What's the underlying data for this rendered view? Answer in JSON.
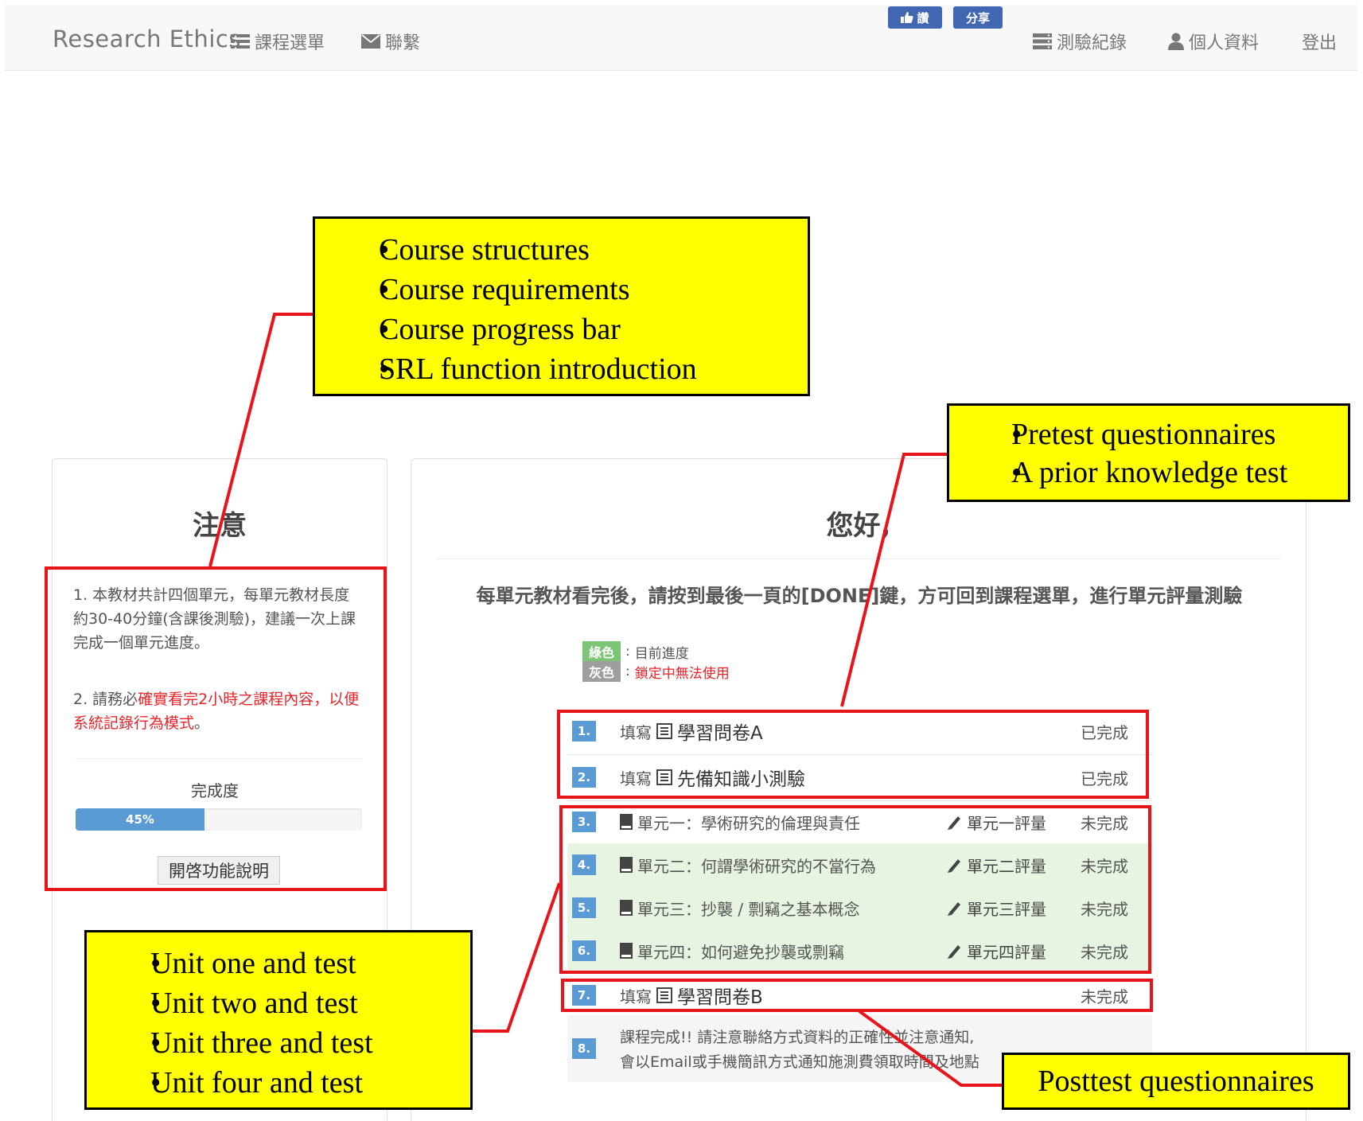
{
  "navbar": {
    "brand": "Research Ethics",
    "course_menu": "課程選單",
    "contact": "聯繫",
    "like": "讚",
    "share": "分享",
    "quiz_records": "測驗紀錄",
    "profile": "個人資料",
    "logout": "登出"
  },
  "notice": {
    "title": "注意",
    "item1": "1. 本教材共計四個單元，每單元教材長度約30-40分鐘(含課後測驗)，建議一次上課完成一個單元進度。",
    "item2_prefix": "2. 請務必",
    "item2_red": "確實看完2小時之課程內容，以便系統記錄行為模式",
    "item2_suffix": "。",
    "progress_label": "完成度",
    "progress_value": 45,
    "progress_text": "45%",
    "function_button": "開啓功能說明"
  },
  "main": {
    "greeting": "您好,",
    "instruction": "每單元教材看完後，請按到最後一頁的[DONE]鍵，方可回到課程選單，進行單元評量測驗",
    "legend": [
      {
        "badge": "綠色",
        "color": "#7cc576",
        "text": "目前進度",
        "text_color": "#555555"
      },
      {
        "badge": "灰色",
        "color": "#9e9e9e",
        "text": "鎖定中無法使用",
        "text_color": "#e8232a"
      }
    ],
    "steps": [
      {
        "num": "1.",
        "prefix": "填寫",
        "label": "學習問卷A",
        "status": "已完成"
      },
      {
        "num": "2.",
        "prefix": "填寫",
        "label": "先備知識小測驗",
        "status": "已完成"
      },
      {
        "num": "3.",
        "label": "單元一：學術研究的倫理與責任",
        "test": "單元一評量",
        "status": "未完成"
      },
      {
        "num": "4.",
        "label": "單元二：何謂學術研究的不當行為",
        "test": "單元二評量",
        "status": "未完成"
      },
      {
        "num": "5.",
        "label": "單元三：抄襲 / 剽竊之基本概念",
        "test": "單元三評量",
        "status": "未完成"
      },
      {
        "num": "6.",
        "label": "單元四：如何避免抄襲或剽竊",
        "test": "單元四評量",
        "status": "未完成"
      },
      {
        "num": "7.",
        "prefix": "填寫",
        "label": "學習問卷B",
        "status": "未完成"
      },
      {
        "num": "8.",
        "line1": "課程完成!! 請注意聯絡方式資料的正確性並注意通知,",
        "line2": "會以Email或手機簡訊方式通知施測費領取時間及地點"
      }
    ]
  },
  "annotations": {
    "course_info": [
      "Course structures",
      "Course requirements",
      "Course progress bar",
      "SRL function introduction"
    ],
    "pretest": [
      "Pretest questionnaires",
      "A prior knowledge test"
    ],
    "units": [
      "Unit one and test",
      "Unit two and test",
      "Unit three and test",
      "Unit four and test"
    ],
    "posttest": "Posttest questionnaires"
  }
}
